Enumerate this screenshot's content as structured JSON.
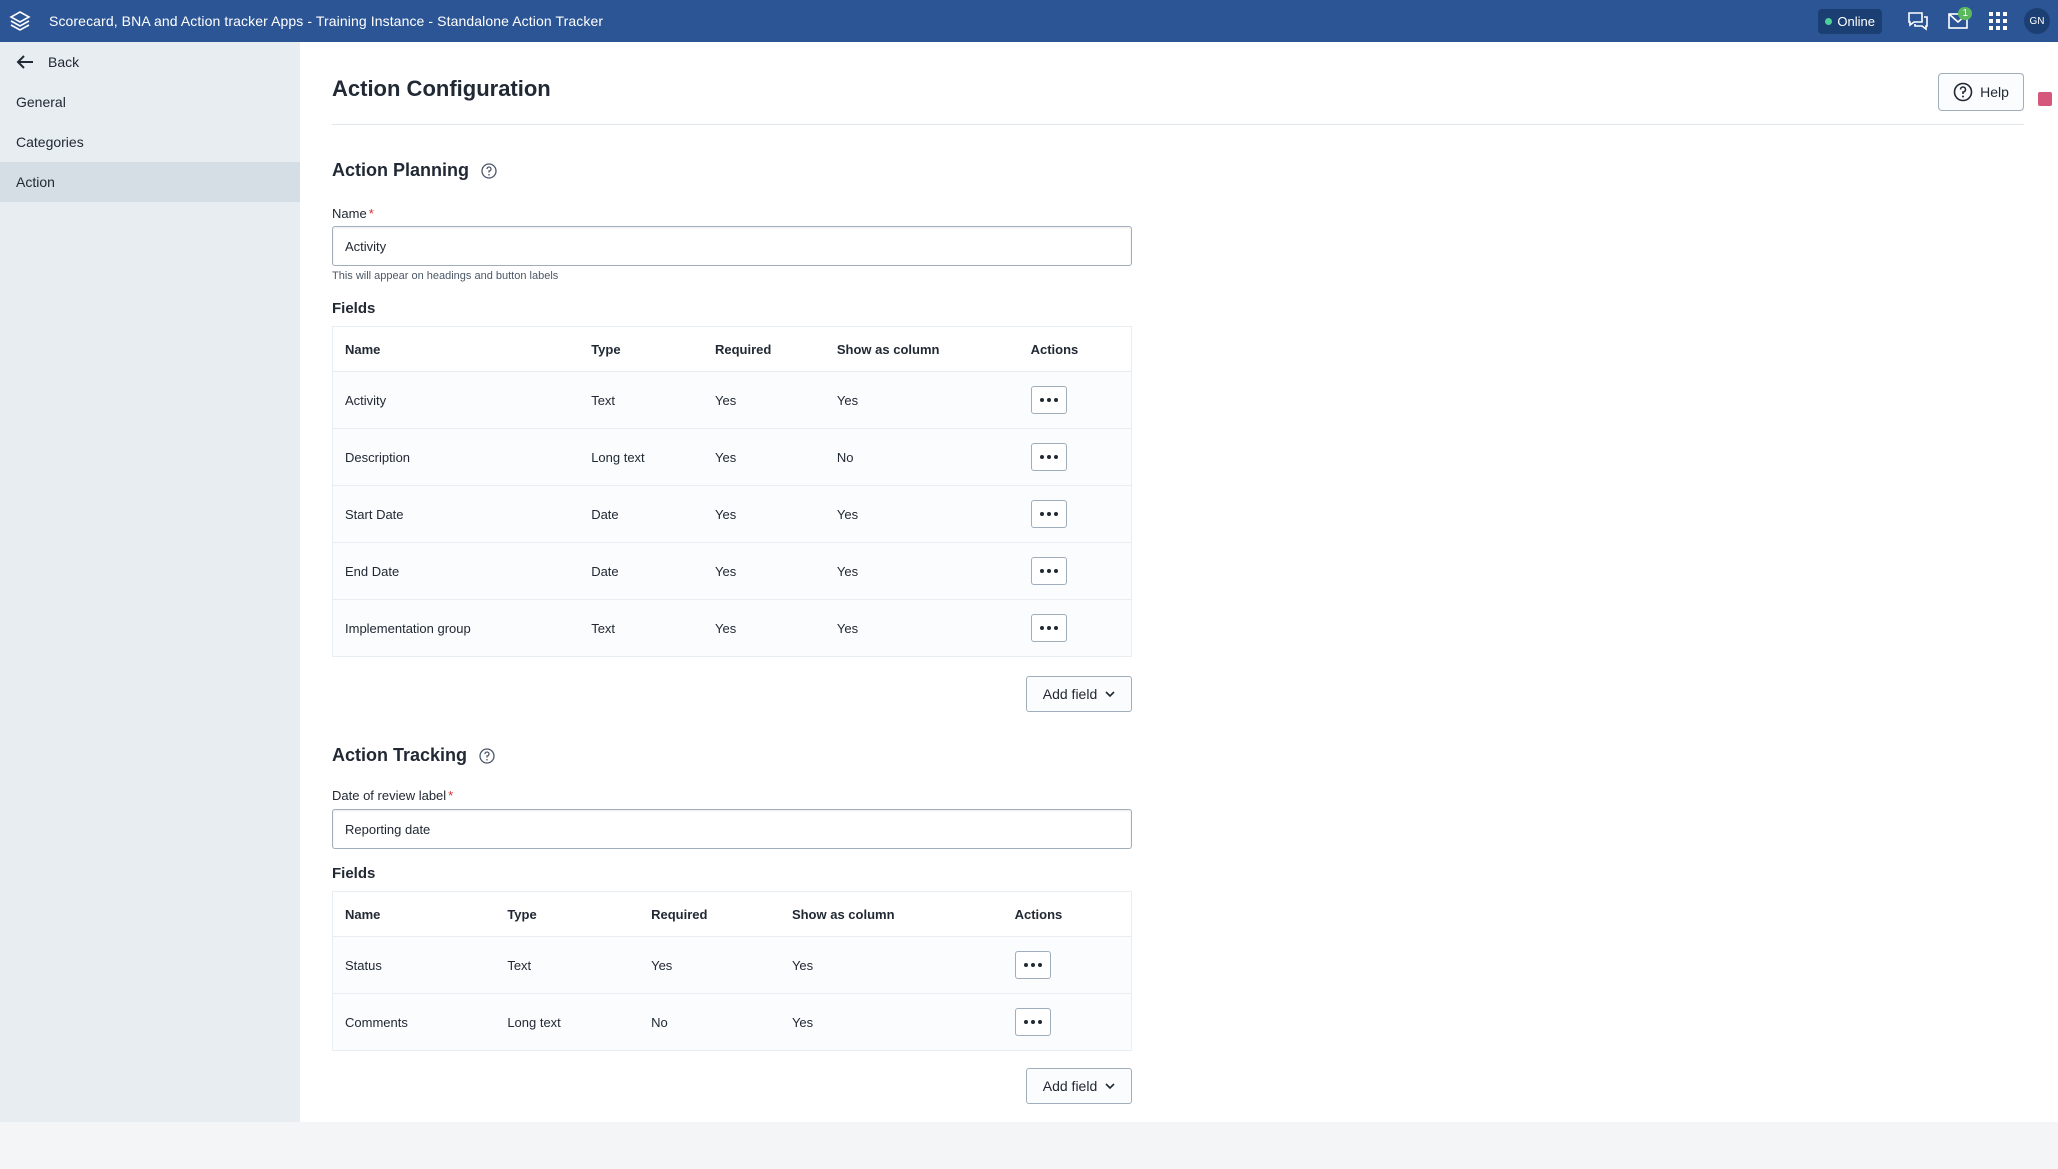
{
  "header": {
    "title": "Scorecard, BNA and Action tracker Apps - Training Instance - Standalone Action Tracker",
    "status": "Online",
    "notification_count": "1",
    "avatar_initials": "GN"
  },
  "sidebar": {
    "back_label": "Back",
    "items": [
      {
        "label": "General"
      },
      {
        "label": "Categories"
      },
      {
        "label": "Action"
      }
    ]
  },
  "main": {
    "title": "Action Configuration",
    "help_label": "Help",
    "planning": {
      "title": "Action Planning",
      "name_label": "Name",
      "name_value": "Activity",
      "name_help": "This will appear on headings and button labels",
      "fields_heading": "Fields",
      "columns": [
        "Name",
        "Type",
        "Required",
        "Show as column",
        "Actions"
      ],
      "rows": [
        {
          "name": "Activity",
          "type": "Text",
          "required": "Yes",
          "show": "Yes"
        },
        {
          "name": "Description",
          "type": "Long text",
          "required": "Yes",
          "show": "No"
        },
        {
          "name": "Start Date",
          "type": "Date",
          "required": "Yes",
          "show": "Yes"
        },
        {
          "name": "End Date",
          "type": "Date",
          "required": "Yes",
          "show": "Yes"
        },
        {
          "name": "Implementation group",
          "type": "Text",
          "required": "Yes",
          "show": "Yes"
        }
      ],
      "add_field_label": "Add field"
    },
    "tracking": {
      "title": "Action Tracking",
      "date_label": "Date of review label",
      "date_value": "Reporting date",
      "fields_heading": "Fields",
      "columns": [
        "Name",
        "Type",
        "Required",
        "Show as column",
        "Actions"
      ],
      "rows": [
        {
          "name": "Status",
          "type": "Text",
          "required": "Yes",
          "show": "Yes"
        },
        {
          "name": "Comments",
          "type": "Long text",
          "required": "No",
          "show": "Yes"
        }
      ],
      "add_field_label": "Add field"
    }
  },
  "colors": {
    "header_bg": "#2c5596",
    "sidebar_bg": "#e8edf2",
    "required_mark": "#d32f2f",
    "online_dot": "#4dd09a"
  }
}
